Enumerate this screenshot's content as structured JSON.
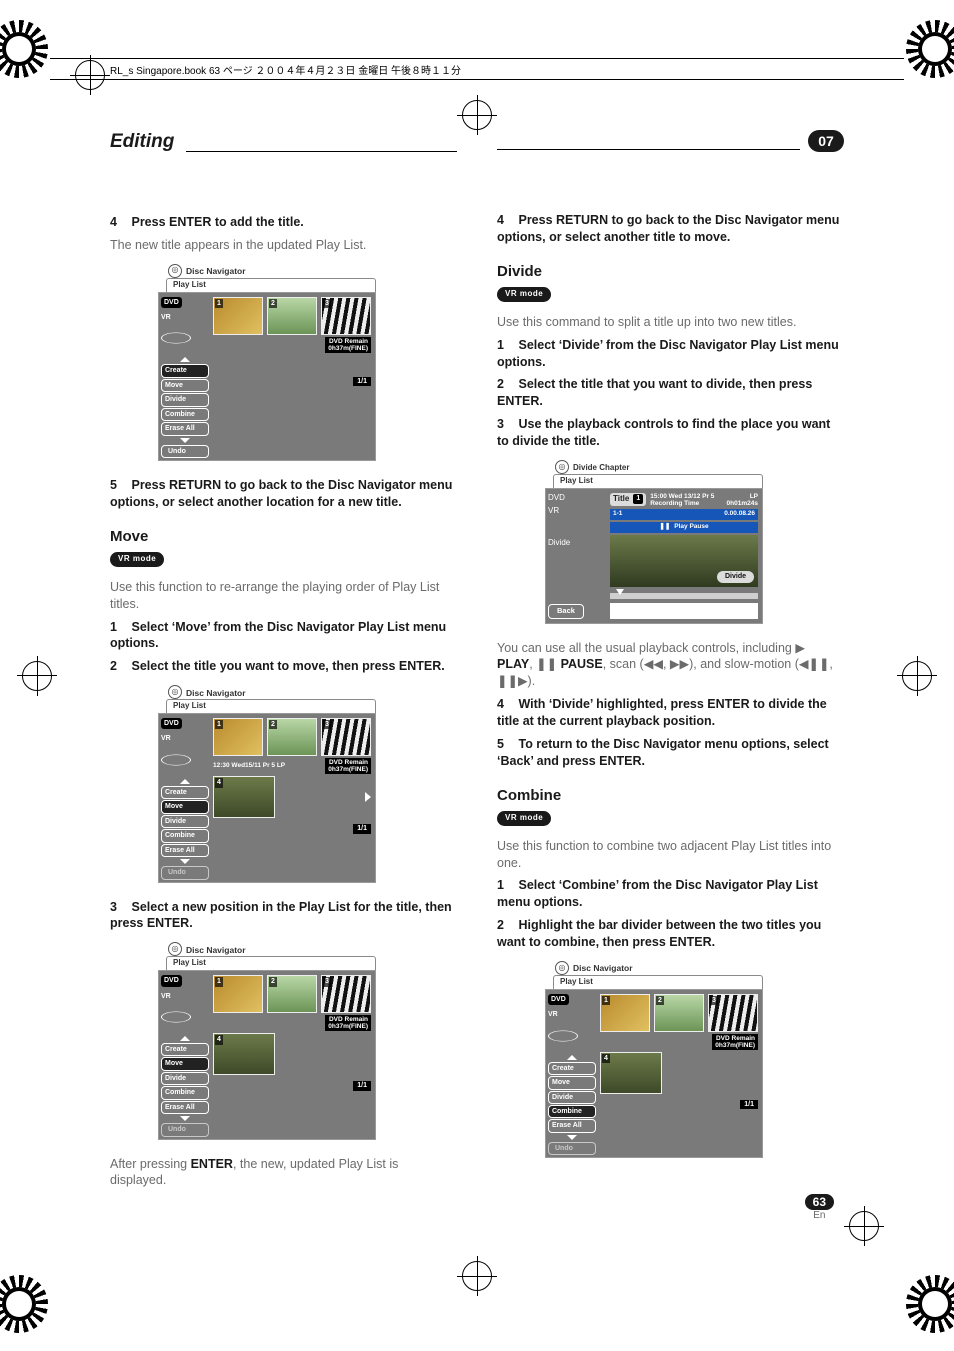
{
  "file_header": "RL_s Singapore.book 63 ページ ２００４年４月２３日 金曜日 午後８時１１分",
  "section": {
    "title": "Editing",
    "chapter_badge": "07"
  },
  "left": {
    "step4_line": {
      "num": "4",
      "bold": "Press ENTER to add the title."
    },
    "step4_sub": "The new title appears in the updated Play List.",
    "nav1": {
      "header_icon": "disc-navigator-icon",
      "header_title": "Disc Navigator",
      "tab": "Play List",
      "side": {
        "dvd": "DVD",
        "vr": "VR",
        "menu": [
          "Create",
          "Move",
          "Divide",
          "Combine",
          "Erase All"
        ],
        "selected": 0,
        "undo": "Undo"
      },
      "thumbs": [
        {
          "n": "1"
        },
        {
          "n": "2"
        },
        {
          "n": "3"
        }
      ],
      "remain": {
        "l1": "DVD Remain",
        "l2": "0h37m(FINE)"
      },
      "page": "1/1"
    },
    "step5_line": {
      "num": "5",
      "bold": "Press RETURN to go back to the Disc Navigator menu options, or select another location for a new title."
    },
    "move_head": "Move",
    "vr_pill": "VR mode",
    "move_intro": "Use this function to re-arrange the playing order of Play List titles.",
    "move_step1": {
      "num": "1",
      "bold": "Select ‘Move’ from the Disc Navigator Play List menu options."
    },
    "move_step2": {
      "num": "2",
      "bold": "Select the title you want to move, then press ENTER."
    },
    "nav2": {
      "header_title": "Disc Navigator",
      "tab": "Play List",
      "side": {
        "dvd": "DVD",
        "vr": "VR",
        "menu": [
          "Create",
          "Move",
          "Divide",
          "Combine",
          "Erase All"
        ],
        "selected": 1,
        "undo": "Undo",
        "undo_dim": true
      },
      "thumbs": [
        {
          "n": "1"
        },
        {
          "n": "2"
        },
        {
          "n": "3"
        }
      ],
      "detail_line": "12:30 Wed15/11  Pr 5   LP",
      "remain": {
        "l1": "DVD Remain",
        "l2": "0h37m(FINE)"
      },
      "big_n": "4",
      "page": "1/1"
    },
    "move_step3": {
      "num": "3",
      "bold": "Select a new position in the Play List for the title, then press ENTER."
    },
    "nav3": {
      "header_title": "Disc Navigator",
      "tab": "Play List",
      "side": {
        "dvd": "DVD",
        "vr": "VR",
        "menu": [
          "Create",
          "Move",
          "Divide",
          "Combine",
          "Erase All"
        ],
        "selected": 1,
        "undo": "Undo",
        "undo_dim": true
      },
      "thumbs": [
        {
          "n": "1"
        },
        {
          "n": "2"
        },
        {
          "n": "3"
        }
      ],
      "remain": {
        "l1": "DVD Remain",
        "l2": "0h37m(FINE)"
      },
      "big_n": "4",
      "page": "1/1"
    },
    "move_after_pre": "After pressing ",
    "move_after_bold": "ENTER",
    "move_after_post": ", the new, updated Play List is displayed."
  },
  "right": {
    "r_step4": {
      "num": "4",
      "bold": "Press RETURN to go back to the Disc Navigator menu options, or select another title to move."
    },
    "divide_head": "Divide",
    "vr_pill": "VR mode",
    "divide_intro": "Use this command to split a title up into two new titles.",
    "divide_step1": {
      "num": "1",
      "bold": "Select ‘Divide’ from the Disc Navigator Play List menu options."
    },
    "divide_step2": {
      "num": "2",
      "bold": "Select the title that you want to divide, then press ENTER."
    },
    "divide_step3": {
      "num": "3",
      "bold": "Use the playback controls to find the place you want to divide the title."
    },
    "dc": {
      "header_title": "Divide Chapter",
      "tab": "Play List",
      "side_dvd": "DVD",
      "side_vr": "VR",
      "side_divide": "Divide",
      "side_back": "Back",
      "title_label": "Title",
      "title_num": "1",
      "meta1_l": "15:00 Wed  13/12   Pr 5",
      "meta1_r": "LP",
      "meta2_l": "Recording Time",
      "meta2_r": "0h01m24s",
      "status_l": "1-1",
      "status_r": "0.00.08.26",
      "status_pp_sym": "❚❚",
      "status_pp": "Play Pause",
      "divide_chip": "Divide"
    },
    "divide_note_pre": "You can use all the usual playback controls, including ",
    "divide_note_play_sym": "▶",
    "divide_note_play": " PLAY",
    "divide_note_sep1": ", ",
    "divide_note_pause_sym": "❚❚",
    "divide_note_pause": " PAUSE",
    "divide_note_mid": ", scan (◀◀, ▶▶), and slow-motion (◀❚❚, ❚❚▶).",
    "divide_step4": {
      "num": "4",
      "bold": "With ‘Divide’ highlighted, press ENTER to divide the title at the current playback position."
    },
    "divide_step5": {
      "num": "5",
      "bold": "To return to the Disc Navigator menu options, select ‘Back’ and press ENTER."
    },
    "combine_head": "Combine",
    "combine_intro": "Use this function to combine two adjacent Play List titles into one.",
    "combine_step1": {
      "num": "1",
      "bold": "Select ‘Combine’ from the Disc Navigator Play List menu options."
    },
    "combine_step2": {
      "num": "2",
      "bold": "Highlight the bar divider between the two titles you want to combine, then press ENTER."
    },
    "nav4": {
      "header_title": "Disc Navigator",
      "tab": "Play List",
      "side": {
        "dvd": "DVD",
        "vr": "VR",
        "menu": [
          "Create",
          "Move",
          "Divide",
          "Combine",
          "Erase All"
        ],
        "selected": 3,
        "undo": "Undo",
        "undo_dim": true
      },
      "thumbs": [
        {
          "n": "1"
        },
        {
          "n": "2"
        },
        {
          "n": "3"
        }
      ],
      "remain": {
        "l1": "DVD Remain",
        "l2": "0h37m(FINE)"
      },
      "big_n": "4",
      "page": "1/1"
    }
  },
  "page_number": {
    "num": "63",
    "lang": "En"
  }
}
